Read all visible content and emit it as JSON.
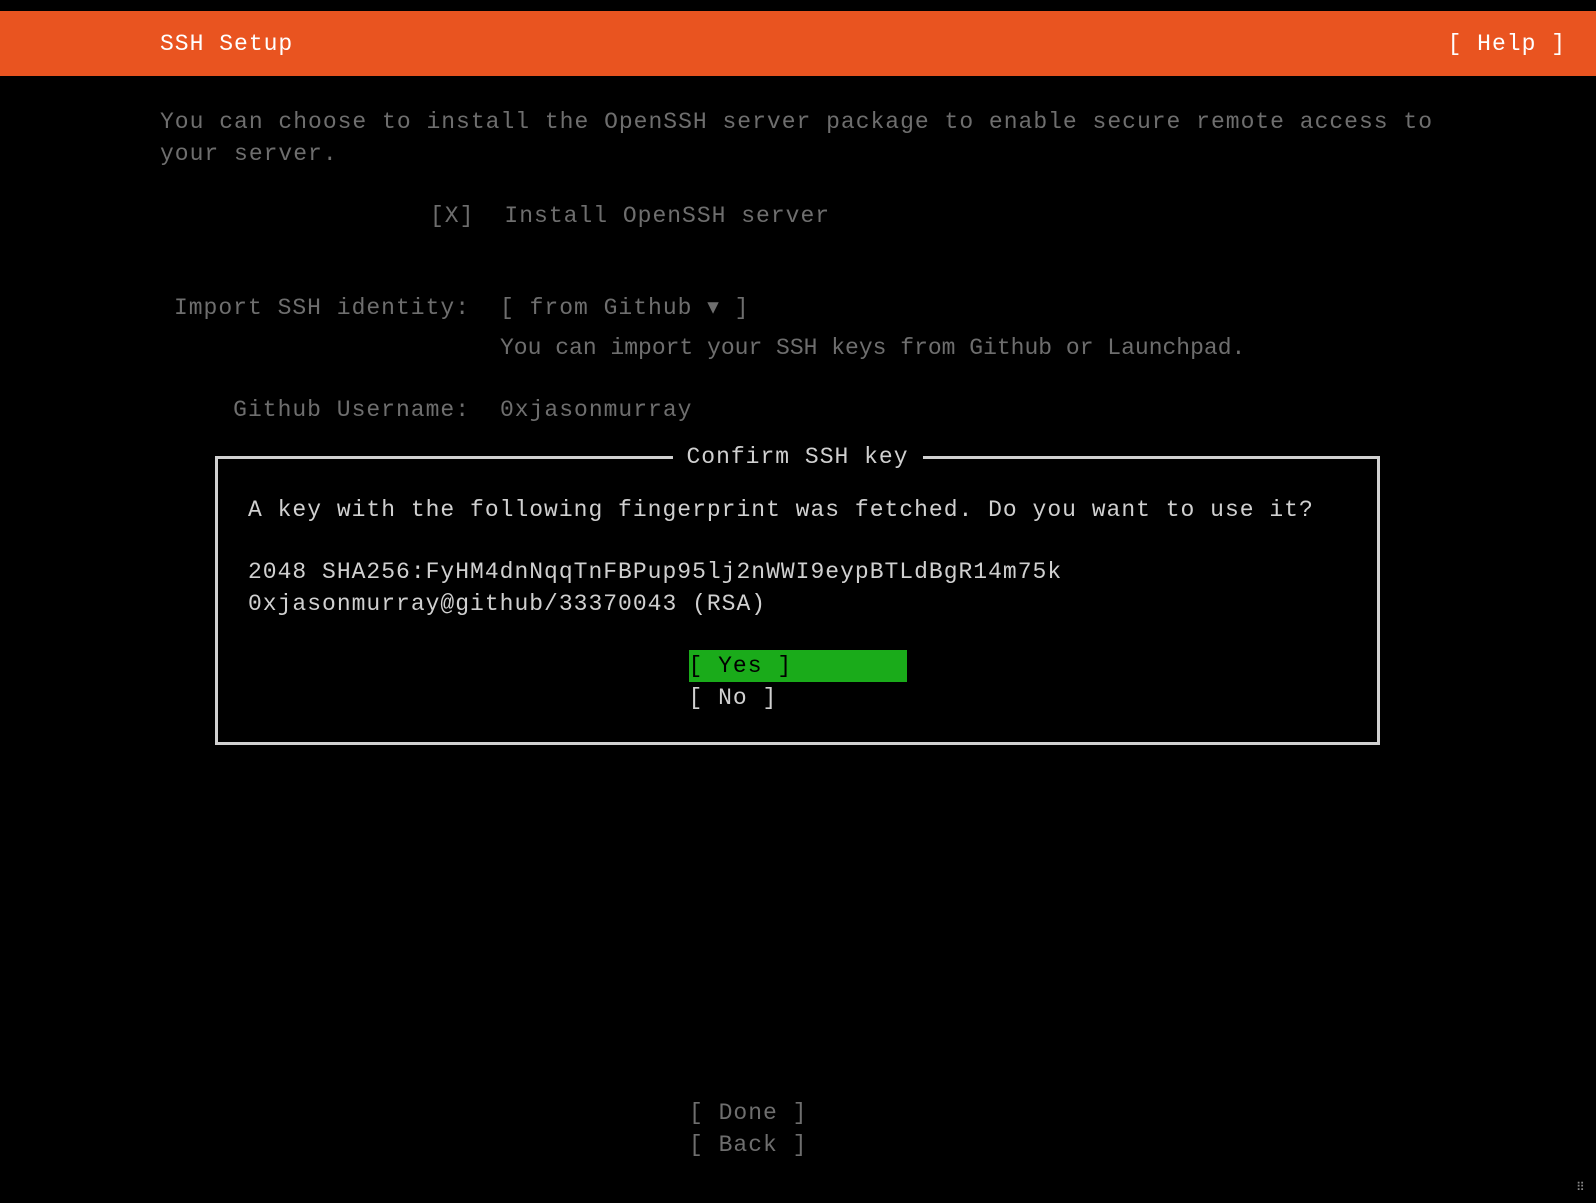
{
  "header": {
    "title": "SSH Setup",
    "help_label": "[ Help ]"
  },
  "intro": "You can choose to install the OpenSSH server package to enable secure remote access to your server.",
  "checkbox": {
    "mark": "[X]",
    "label": "Install OpenSSH server"
  },
  "import": {
    "label": "Import SSH identity:",
    "dropdown": "[ from Github     ▾ ]",
    "help": "You can import your SSH keys from Github or Launchpad."
  },
  "username": {
    "label": "Github Username:",
    "value": "0xjasonmurray"
  },
  "dialog": {
    "title": "Confirm SSH key",
    "message": "A key with the following fingerprint was fetched. Do you want to use it?",
    "fingerprint_line1": "2048 SHA256:FyHM4dnNqqTnFBPup95lj2nWWI9eypBTLdBgR14m75k",
    "fingerprint_line2": "0xjasonmurray@github/33370043  (RSA)",
    "yes": "[ Yes          ]",
    "no": "[ No           ]"
  },
  "footer": {
    "done": "[ Done        ]",
    "back": "[ Back        ]"
  }
}
